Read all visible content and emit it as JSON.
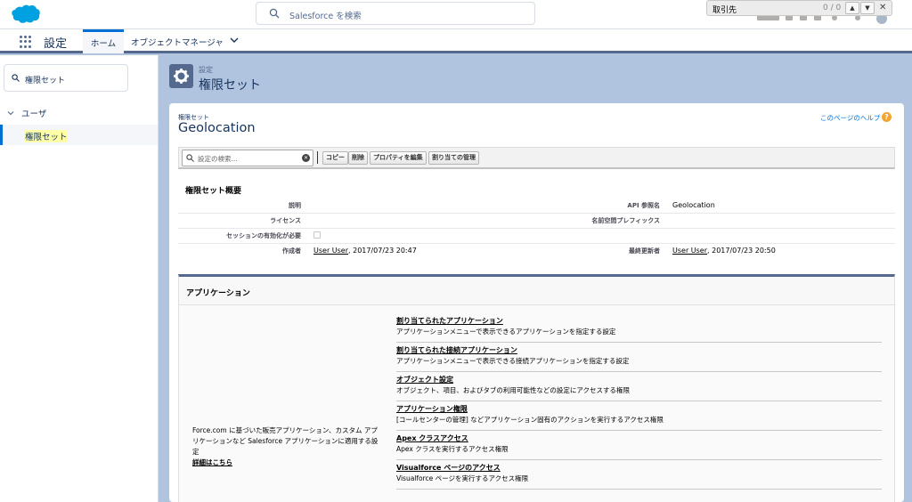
{
  "global_header": {
    "search_placeholder": "Salesforce を検索",
    "find_bar": {
      "text": "取引先",
      "count": "0 / 0",
      "prev": "▲",
      "next": "▼",
      "close": "✕"
    }
  },
  "context_bar": {
    "app_name": "設定",
    "tabs": [
      {
        "label": "ホーム"
      },
      {
        "label": "オブジェクトマネージャ"
      }
    ]
  },
  "sidebar": {
    "quickfind_value": "権限セット",
    "group_label": "ユーザ",
    "selected_item": "権限セット"
  },
  "page_header": {
    "eyebrow": "設定",
    "title": "権限セット"
  },
  "main": {
    "eyebrow": "権限セット",
    "title": "Geolocation",
    "help_link": "このページのヘルプ",
    "toolbar": {
      "search_placeholder": "設定の検索...",
      "buttons": [
        "コピー",
        "削除",
        "プロパティを編集",
        "割り当ての管理"
      ]
    },
    "overview": {
      "title": "権限セット概要",
      "labels": {
        "description": "説明",
        "license": "ライセンス",
        "session": "セッションの有効化が必要",
        "created_by": "作成者",
        "api_name": "API 参照名",
        "namespace": "名前空間プレフィックス",
        "modified_by": "最終更新者"
      },
      "values": {
        "api_name": "Geolocation",
        "created_user": "User User",
        "created_date": ", 2017/07/23 20:47",
        "modified_user": "User User",
        "modified_date": ", 2017/07/23 20:50"
      }
    },
    "apps": {
      "title": "アプリケーション",
      "description": "Force.com に基づいた販売アプリケーション、カスタム アプリケーションなど Salesforce アプリケーションに適用する設定",
      "more_link": "詳細はこちら",
      "items": [
        {
          "title": "割り当てられたアプリケーション",
          "desc": "アプリケーションメニューで表示できるアプリケーションを指定する設定"
        },
        {
          "title": "割り当てられた接続アプリケーション",
          "desc": "アプリケーションメニューで表示できる接続アプリケーションを指定する設定"
        },
        {
          "title": "オブジェクト設定",
          "desc": "オブジェクト、項目、およびタブの利用可能性などの設定にアクセスする権限"
        },
        {
          "title": "アプリケーション権限",
          "desc": "[コールセンターの管理] などアプリケーション固有のアクションを実行するアクセス権限"
        },
        {
          "title": "Apex クラスアクセス",
          "desc": "Apex クラスを実行するアクセス権限"
        },
        {
          "title": "Visualforce ページのアクセス",
          "desc": "Visualforce ページを実行するアクセス権限"
        }
      ]
    }
  }
}
